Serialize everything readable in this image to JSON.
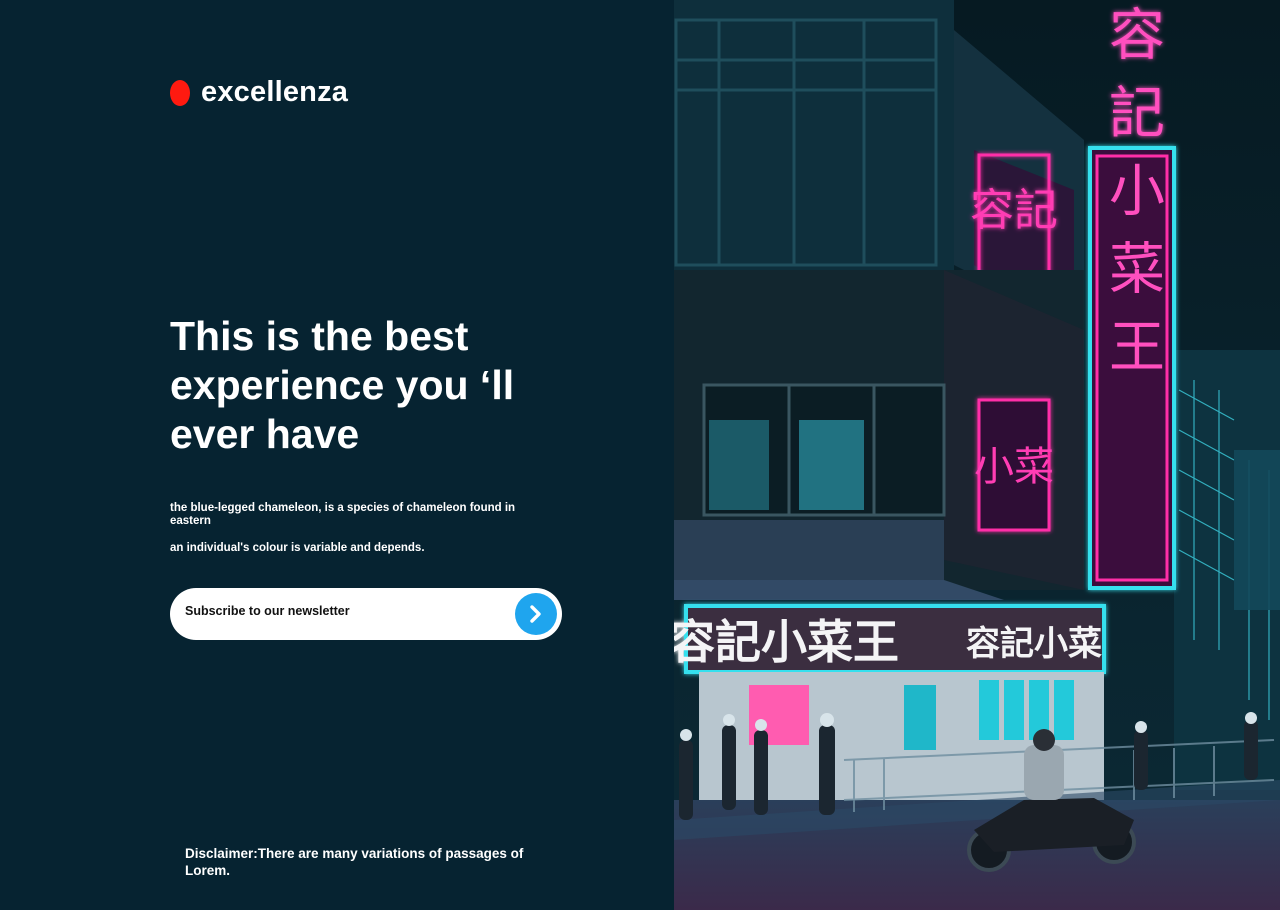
{
  "brand": {
    "name": "excellenza",
    "dot_color": "#ff1a10"
  },
  "hero": {
    "headline": "This is the best experience you ‘ll ever have",
    "description_line1": "the blue-legged chameleon, is a species of chameleon found in eastern",
    "description_line2": "an individual's colour is variable and depends."
  },
  "newsletter": {
    "label": "Subscribe to our newsletter",
    "button_icon": "chevron-right-icon",
    "button_color": "#1fa5ee"
  },
  "footer": {
    "disclaimer": "Disclaimer:There are many variations of passages of Lorem."
  },
  "photo": {
    "sign_vertical": "容記小菜王",
    "sign_storefront": "容記小菜王",
    "sign_storefront_small": "容記小菜",
    "sign_neon_left": "容記",
    "sign_neon_left_lower": "小菜",
    "neon_pink": "#ff2fa8",
    "neon_cyan": "#33e3f0"
  },
  "colors": {
    "background": "#062331",
    "text": "#ffffff"
  }
}
